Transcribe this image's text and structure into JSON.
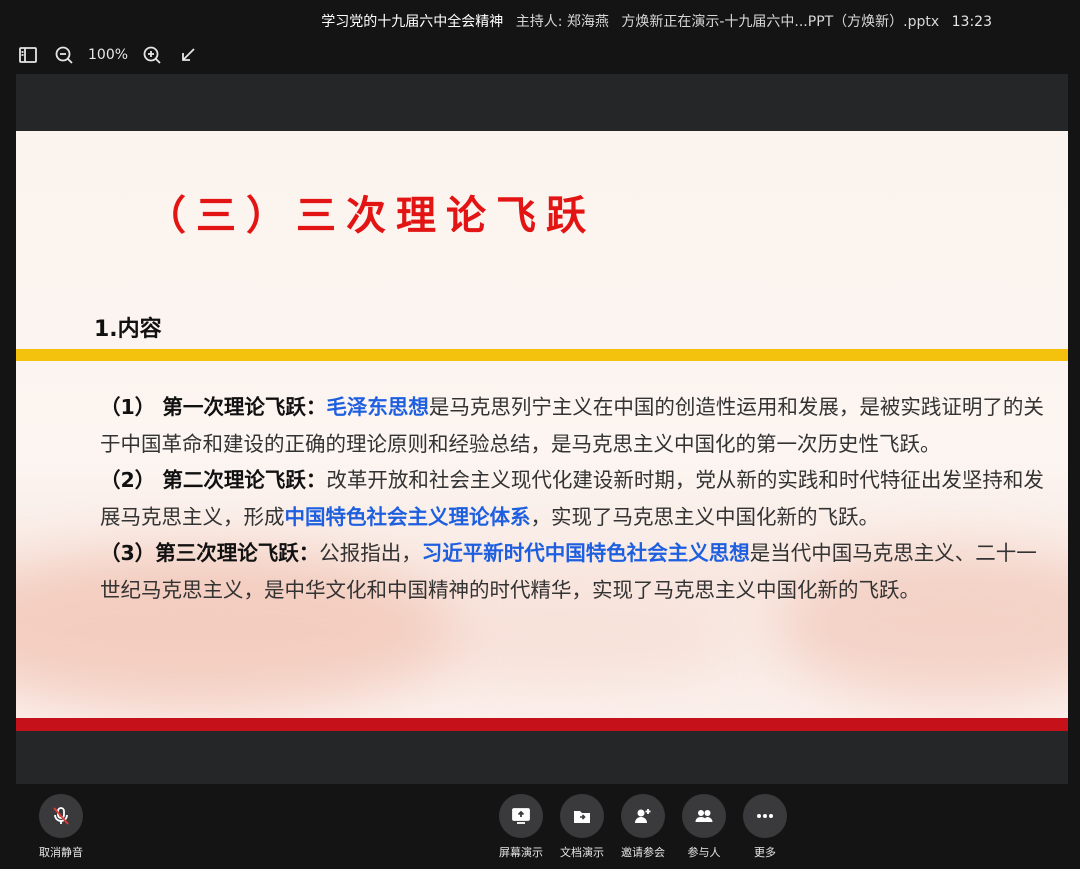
{
  "window": {
    "meeting_title": "学习党的十九届六中全会精神",
    "host": "主持人: 郑海燕",
    "presenting": "方焕新正在演示-十九届六中...PPT（方焕新）.pptx",
    "time": "13:23"
  },
  "toolbar": {
    "zoom": "100%"
  },
  "slide": {
    "title": "（三）三次理论飞跃",
    "section": "1.内容",
    "paragraphs": [
      {
        "lead": "（1） 第一次理论飞跃：",
        "highlight": "毛泽东思想",
        "text": "是马克思列宁主义在中国的创造性运用和发展，是被实践证明了的关于中国革命和建设的正确的理论原则和经验总结，是马克思主义中国化的第一次历史性飞跃。"
      },
      {
        "lead": "（2） 第二次理论飞跃：",
        "text_before": "改革开放和社会主义现代化建设新时期，党从新的实践和时代特征出发坚持和发展马克思主义，形成",
        "highlight": "中国特色社会主义理论体系",
        "text": "，实现了马克思主义中国化新的飞跃。"
      },
      {
        "lead": "（3）第三次理论飞跃：",
        "text_before": "公报指出，",
        "highlight": "习近平新时代中国特色社会主义思想",
        "text": "是当代中国马克思主义、二十一世纪马克思主义，是中华文化和中国精神的时代精华，实现了马克思主义中国化新的飞跃。"
      }
    ]
  },
  "controls": {
    "unmute": "取消静音",
    "screen_share": "屏幕演示",
    "doc_share": "文档演示",
    "invite": "邀请参会",
    "participants": "参与人",
    "more": "更多"
  },
  "colors": {
    "title_red": "#e31414",
    "highlight_blue": "#1e5fe0",
    "accent_yellow": "#f4c20d",
    "footer_red": "#c5121a"
  }
}
